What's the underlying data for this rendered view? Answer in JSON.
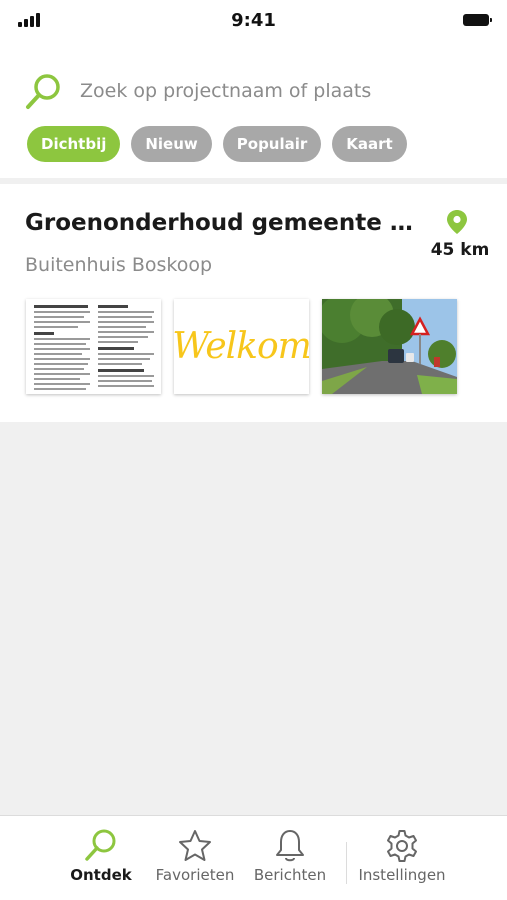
{
  "status_bar": {
    "time": "9:41"
  },
  "search": {
    "placeholder": "Zoek op projectnaam of plaats",
    "value": ""
  },
  "filters": [
    {
      "label": "Dichtbij",
      "active": true
    },
    {
      "label": "Nieuw",
      "active": false
    },
    {
      "label": "Populair",
      "active": false
    },
    {
      "label": "Kaart",
      "active": false
    }
  ],
  "project_card": {
    "title": "Groenonderhoud gemeente Voo...",
    "subtitle": "Buitenhuis Boskoop",
    "distance": "45 km",
    "thumbnails": [
      {
        "type": "document"
      },
      {
        "type": "welcome",
        "text": "Welkom"
      },
      {
        "type": "photo"
      }
    ]
  },
  "tab_bar": {
    "tabs": [
      {
        "label": "Ontdek",
        "icon": "search-icon",
        "active": true
      },
      {
        "label": "Favorieten",
        "icon": "star-icon",
        "active": false
      },
      {
        "label": "Berichten",
        "icon": "bell-icon",
        "active": false
      },
      {
        "label": "Instellingen",
        "icon": "gear-icon",
        "active": false
      }
    ]
  },
  "colors": {
    "accent": "#8dc63f",
    "chip_inactive": "#a8a8a8",
    "text_secondary": "#8b8b8b",
    "welcome_yellow": "#f7c61b",
    "background": "#f0f0f0"
  }
}
